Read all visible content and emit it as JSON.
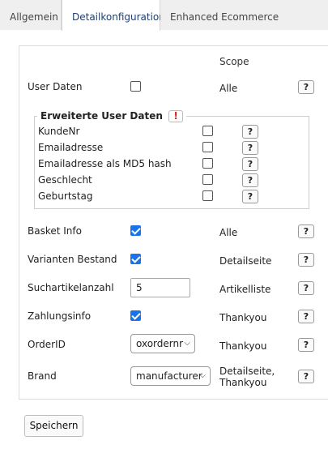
{
  "tabs": [
    {
      "label": "Allgemein"
    },
    {
      "label": "Detailkonfiguration"
    },
    {
      "label": "Enhanced Ecommerce"
    }
  ],
  "scope_header": "Scope",
  "user_daten": {
    "label": "User Daten",
    "checked": false,
    "scope": "Alle"
  },
  "help_label": "?",
  "erweiterte": {
    "title": "Erweiterte User Daten",
    "warning": "!",
    "items": [
      {
        "label": "KundeNr",
        "checked": false
      },
      {
        "label": "Emailadresse",
        "checked": false
      },
      {
        "label": "Emailadresse als MD5 hash",
        "checked": false
      },
      {
        "label": "Geschlecht",
        "checked": false
      },
      {
        "label": "Geburtstag",
        "checked": false
      }
    ]
  },
  "rows": {
    "basket": {
      "label": "Basket Info",
      "checked": true,
      "scope": "Alle"
    },
    "varianten": {
      "label": "Varianten Bestand",
      "checked": true,
      "scope": "Detailseite"
    },
    "suchartikel": {
      "label": "Suchartikelanzahl",
      "value": "5",
      "scope": "Artikelliste"
    },
    "zahlung": {
      "label": "Zahlungsinfo",
      "checked": true,
      "scope": "Thankyou"
    },
    "orderid": {
      "label": "OrderID",
      "selected": "oxordernr",
      "scope": "Thankyou"
    },
    "brand": {
      "label": "Brand",
      "selected": "manufacturer",
      "scope_line1": "Detailseite,",
      "scope_line2": "Thankyou"
    }
  },
  "save_label": "Speichern",
  "colors": {
    "accent": "#1a73e8",
    "warning": "#e02020",
    "active_tab_text": "#1f3f6e"
  }
}
